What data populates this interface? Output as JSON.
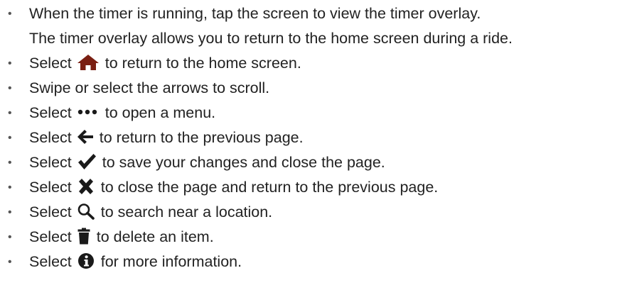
{
  "bullet_glyph": "•",
  "items": [
    {
      "line1": "When the timer is running, tap the screen to view the timer overlay.",
      "line2": "The timer overlay allows you to return to the home screen during a ride."
    },
    {
      "before": "Select",
      "icon": "home-icon",
      "after": "to return to the home screen."
    },
    {
      "text": "Swipe or select the arrows to scroll."
    },
    {
      "before": "Select",
      "icon": "ellipsis-icon",
      "after": "to open a menu."
    },
    {
      "before": "Select",
      "icon": "back-arrow-icon",
      "after": "to return to the previous page."
    },
    {
      "before": "Select",
      "icon": "checkmark-icon",
      "after": "to save your changes and close the page."
    },
    {
      "before": "Select",
      "icon": "close-x-icon",
      "after": "to close the page and return to the previous page."
    },
    {
      "before": "Select",
      "icon": "search-icon",
      "after": "to search near a location."
    },
    {
      "before": "Select",
      "icon": "trash-icon",
      "after": "to delete an item."
    },
    {
      "before": "Select",
      "icon": "info-icon",
      "after": "for more information."
    }
  ],
  "colors": {
    "text": "#222222",
    "home_icon": "#7a1f12",
    "icon_dark": "#1a1a1a"
  }
}
